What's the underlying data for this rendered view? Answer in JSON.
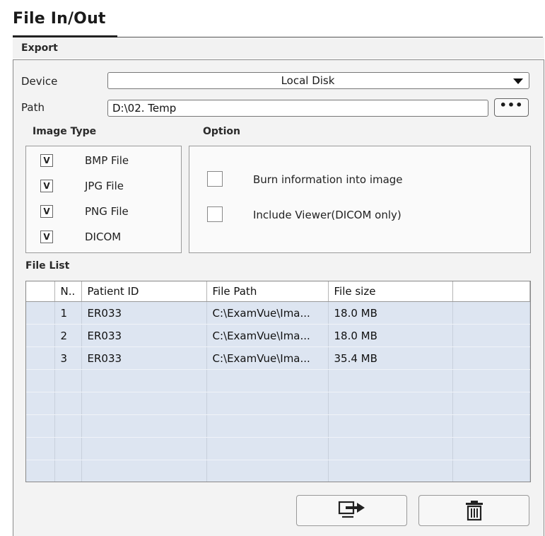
{
  "window": {
    "title": "File In/Out"
  },
  "tab": {
    "label": "Export"
  },
  "device": {
    "label": "Device",
    "value": "Local Disk"
  },
  "path": {
    "label": "Path",
    "value": "D:\\02. Temp",
    "browse_label": "•••"
  },
  "image_type": {
    "label": "Image Type",
    "items": [
      {
        "label": "BMP File",
        "checked": "V"
      },
      {
        "label": "JPG File",
        "checked": "V"
      },
      {
        "label": "PNG File",
        "checked": "V"
      },
      {
        "label": "DICOM",
        "checked": "V"
      }
    ]
  },
  "option": {
    "label": "Option",
    "items": [
      {
        "label": "Burn information into image"
      },
      {
        "label": "Include Viewer(DICOM only)"
      }
    ]
  },
  "file_list": {
    "label": "File List",
    "columns": [
      "N..",
      "Patient ID",
      "File Path",
      "File size"
    ],
    "rows": [
      {
        "no": "1",
        "patient_id": "ER033",
        "file_path": "C:\\ExamVue\\Ima...",
        "file_size": "18.0 MB"
      },
      {
        "no": "2",
        "patient_id": "ER033",
        "file_path": "C:\\ExamVue\\Ima...",
        "file_size": "18.0 MB"
      },
      {
        "no": "3",
        "patient_id": "ER033",
        "file_path": "C:\\ExamVue\\Ima...",
        "file_size": "35.4 MB"
      }
    ]
  },
  "buttons": {
    "export_icon": "export-icon",
    "delete_icon": "trash-icon"
  },
  "colors": {
    "row_bg": "#dde5f1",
    "panel_bg": "#f3f3f3"
  }
}
